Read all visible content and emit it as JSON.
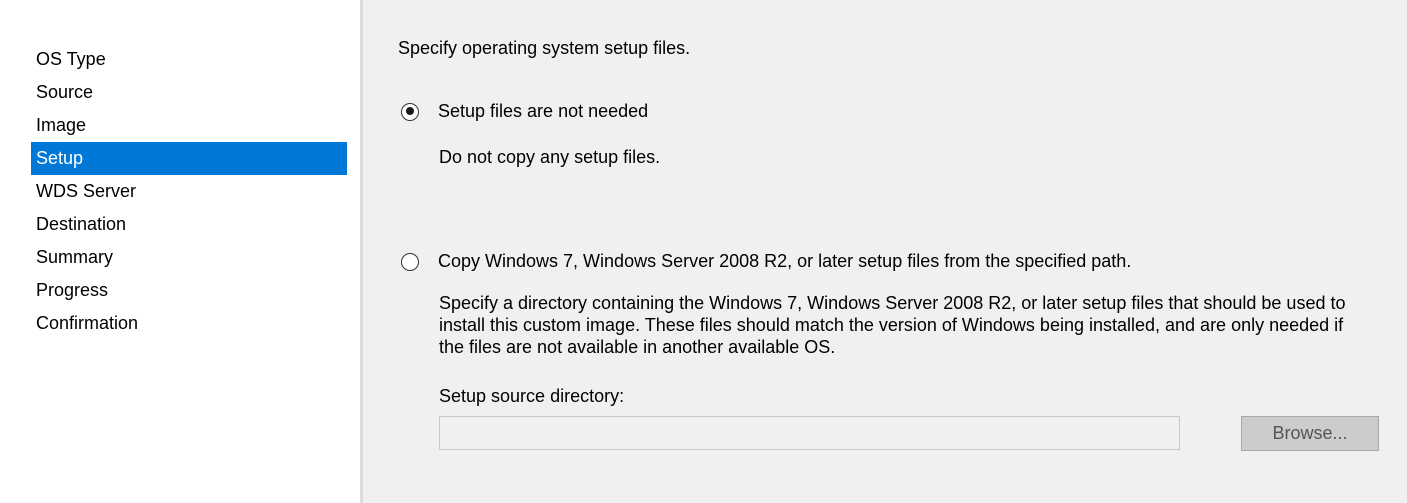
{
  "nav": {
    "items": [
      {
        "label": "OS Type"
      },
      {
        "label": "Source"
      },
      {
        "label": "Image"
      },
      {
        "label": "Setup",
        "selected": true
      },
      {
        "label": "WDS Server"
      },
      {
        "label": "Destination"
      },
      {
        "label": "Summary"
      },
      {
        "label": "Progress"
      },
      {
        "label": "Confirmation"
      }
    ]
  },
  "main": {
    "heading": "Specify operating system setup files.",
    "options": [
      {
        "label": "Setup files are not needed",
        "description": "Do not copy any setup files.",
        "checked": true
      },
      {
        "label": "Copy Windows 7, Windows Server 2008 R2, or later setup files from the specified path.",
        "description": "Specify a directory containing the Windows 7, Windows Server 2008 R2, or later setup files that should be used to install this custom image.  These files should match the version of Windows being installed, and are only needed if the files are not available in another available OS.",
        "checked": false
      }
    ],
    "source_dir": {
      "label": "Setup source directory:",
      "value": "",
      "enabled": false
    },
    "browse_label": "Browse..."
  },
  "colors": {
    "selection": "#0078d7",
    "content_bg": "#f0f0f0",
    "disabled_button_bg": "#cccccc"
  }
}
